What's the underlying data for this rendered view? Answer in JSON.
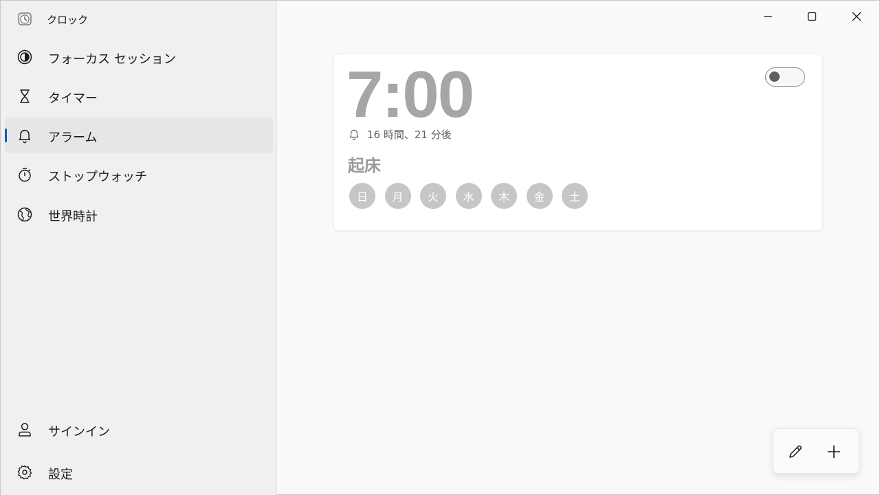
{
  "app": {
    "title": "クロック",
    "icon": "clock-app-icon"
  },
  "sidebar": {
    "items": [
      {
        "label": "フォーカス セッション",
        "icon": "focus-session-icon",
        "selected": false
      },
      {
        "label": "タイマー",
        "icon": "hourglass-icon",
        "selected": false
      },
      {
        "label": "アラーム",
        "icon": "bell-icon",
        "selected": true
      },
      {
        "label": "ストップウォッチ",
        "icon": "stopwatch-icon",
        "selected": false
      },
      {
        "label": "世界時計",
        "icon": "globe-icon",
        "selected": false
      }
    ],
    "footer": [
      {
        "label": "サインイン",
        "icon": "person-icon"
      },
      {
        "label": "設定",
        "icon": "gear-icon"
      }
    ]
  },
  "window_controls": {
    "minimize": "minimize-icon",
    "maximize": "maximize-icon",
    "close": "close-icon"
  },
  "alarm": {
    "time": "7:00",
    "remaining": "16 時間、21 分後",
    "name": "起床",
    "enabled": false,
    "days": [
      "日",
      "月",
      "火",
      "水",
      "木",
      "金",
      "土"
    ]
  },
  "actions": {
    "edit_icon": "pencil-icon",
    "add_icon": "plus-icon"
  },
  "colors": {
    "accent": "#005fb8",
    "day_chip": "#c6c6c6",
    "time_text": "#a6a6a6"
  }
}
